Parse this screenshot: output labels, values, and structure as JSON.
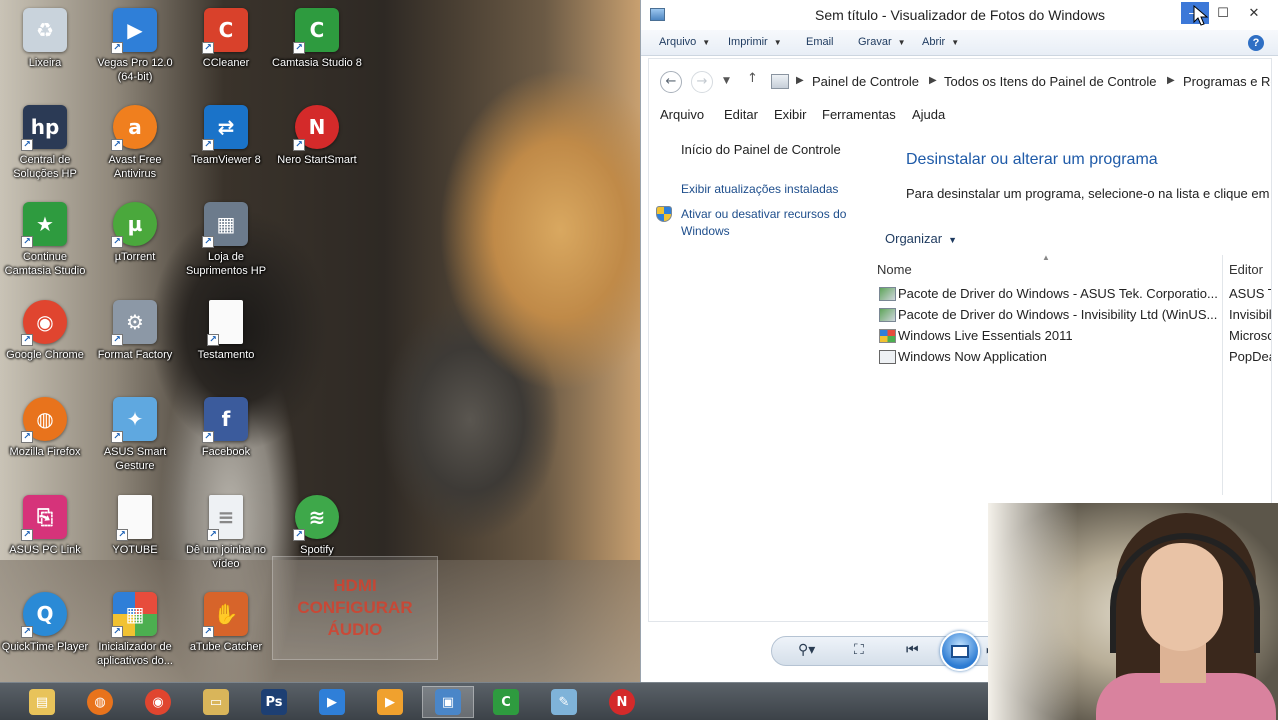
{
  "desktop": {
    "icons": [
      {
        "label": "Lixeira",
        "icon": "recycle-bin-icon",
        "color": "#c9d3dc"
      },
      {
        "label": "Vegas Pro 12.0 (64-bit)",
        "icon": "vegas-pro-icon",
        "color": "#2f7fd8"
      },
      {
        "label": "CCleaner",
        "icon": "ccleaner-icon",
        "color": "#d9412b"
      },
      {
        "label": "Camtasia Studio 8",
        "icon": "camtasia-icon",
        "color": "#2e9b3f"
      },
      {
        "label": "Central de Soluções HP",
        "icon": "hp-icon",
        "color": "#2b3a55"
      },
      {
        "label": "Avast Free Antivirus",
        "icon": "avast-icon",
        "color": "#f07f1e"
      },
      {
        "label": "TeamViewer 8",
        "icon": "teamviewer-icon",
        "color": "#1a73c9"
      },
      {
        "label": "Nero StartSmart",
        "icon": "nero-icon",
        "color": "#d42a2a"
      },
      {
        "label": "Continue Camtasia Studio",
        "icon": "camtasia-continue-icon",
        "color": "#2e9b3f"
      },
      {
        "label": "µTorrent",
        "icon": "utorrent-icon",
        "color": "#4aa83c"
      },
      {
        "label": "Loja de Suprimentos HP",
        "icon": "hp-store-icon",
        "color": "#6c7b8c"
      },
      {
        "label": "Google Chrome",
        "icon": "chrome-icon",
        "color": "#e0452f"
      },
      {
        "label": "Format Factory",
        "icon": "format-factory-icon",
        "color": "#8c98a6"
      },
      {
        "label": "Testamento",
        "icon": "document-icon",
        "color": "#fafafa"
      },
      {
        "label": "Mozilla Firefox",
        "icon": "firefox-icon",
        "color": "#e8731c"
      },
      {
        "label": "ASUS Smart Gesture",
        "icon": "asus-gesture-icon",
        "color": "#5fa8e0"
      },
      {
        "label": "Facebook",
        "icon": "facebook-icon",
        "color": "#3b5b9c"
      },
      {
        "label": "ASUS PC Link",
        "icon": "asus-pclink-icon",
        "color": "#d6337a"
      },
      {
        "label": "YOTUBE",
        "icon": "document-icon",
        "color": "#fafafa"
      },
      {
        "label": "Dê um joinha no vídeo",
        "icon": "text-document-icon",
        "color": "#eef1f4"
      },
      {
        "label": "Spotify",
        "icon": "spotify-icon",
        "color": "#3ea84a"
      },
      {
        "label": "QuickTime Player",
        "icon": "quicktime-icon",
        "color": "#2a8ad6"
      },
      {
        "label": "Inicializador de aplicativos do...",
        "icon": "apps-launcher-icon",
        "color": "#f4f4f4"
      },
      {
        "label": "aTube Catcher",
        "icon": "atube-catcher-icon",
        "color": "#d7642a"
      }
    ],
    "watermark_lines": [
      "HDMI",
      "CONFIGURAR",
      "ÁUDIO"
    ]
  },
  "taskbar": {
    "items": [
      {
        "icon": "file-explorer-icon",
        "color": "#e8c35a"
      },
      {
        "icon": "firefox-icon",
        "color": "#e8731c"
      },
      {
        "icon": "chrome-icon",
        "color": "#e0452f"
      },
      {
        "icon": "folder-icon",
        "color": "#d9b55a"
      },
      {
        "icon": "photoshop-icon",
        "color": "#1d3f73",
        "text": "Ps"
      },
      {
        "icon": "vegas-pro-icon",
        "color": "#2f7fd8"
      },
      {
        "icon": "media-player-icon",
        "color": "#f0a12e"
      },
      {
        "icon": "photo-viewer-icon",
        "color": "#4a86c8"
      },
      {
        "icon": "camtasia-icon",
        "color": "#2e9b3f"
      },
      {
        "icon": "paint-icon",
        "color": "#7fb3d9"
      },
      {
        "icon": "nero-icon",
        "color": "#d42a2a"
      }
    ]
  },
  "viewer": {
    "title": "Sem título - Visualizador de Fotos do Windows",
    "commands": [
      "Arquivo",
      "Imprimir",
      "Email",
      "Gravar",
      "Abrir"
    ],
    "help_label": "?",
    "window_controls": {
      "minimize": "—",
      "maximize": "☐",
      "close": "✕"
    },
    "toolbar": {
      "zoom": "⚲▾",
      "fit": "⛶",
      "prev": "⏮",
      "next": "⏭"
    },
    "photo": {
      "breadcrumbs": [
        "Painel de Controle",
        "Todos os Itens do Painel de Controle",
        "Programas e Re"
      ],
      "menus": [
        "Arquivo",
        "Editar",
        "Exibir",
        "Ferramentas",
        "Ajuda"
      ],
      "sidebar": {
        "home": "Início do Painel de Controle",
        "updates": "Exibir atualizações instaladas",
        "features": "Ativar ou desativar recursos do Windows"
      },
      "content": {
        "title": "Desinstalar ou alterar um programa",
        "description": "Para desinstalar um programa, selecione-o na lista e clique em",
        "organize": "Organizar"
      },
      "columns": {
        "name": "Nome",
        "editor": "Editor"
      },
      "programs": [
        {
          "name": "Pacote de Driver do Windows - ASUS Tek. Corporatio...",
          "editor": "ASUS Te",
          "icon": "driver-package-icon"
        },
        {
          "name": "Pacote de Driver do Windows - Invisibility Ltd (WinUS...",
          "editor": "Invisibil",
          "icon": "driver-package-icon"
        },
        {
          "name": "Windows Live Essentials 2011",
          "editor": "Microso",
          "icon": "windows-live-icon"
        },
        {
          "name": "Windows Now Application",
          "editor": "PopDea",
          "icon": "application-icon"
        }
      ]
    }
  }
}
